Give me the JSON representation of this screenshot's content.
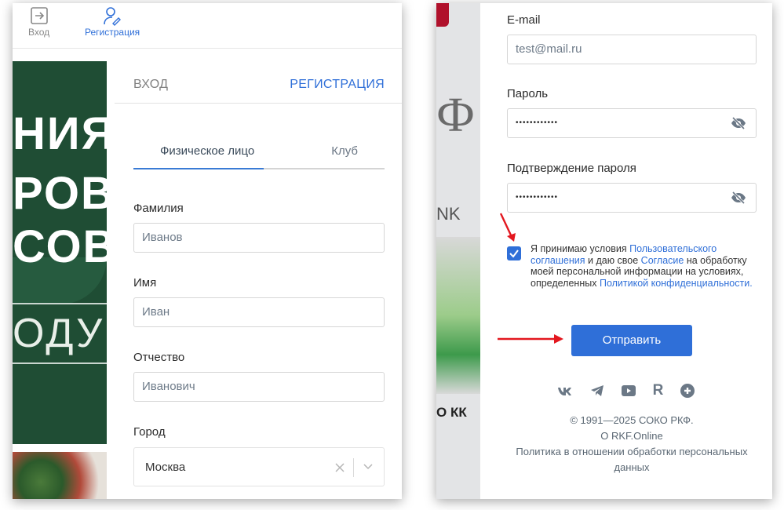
{
  "left": {
    "nav": {
      "login_label": "Вход",
      "register_label": "Регистрация"
    },
    "background": {
      "line1": "НИЯ",
      "line2": "РОВ",
      "line3": "СОВ",
      "line4": "ОДУ"
    },
    "auth_tabs": {
      "login": "ВХОД",
      "register": "РЕГИСТРАЦИЯ"
    },
    "sub_tabs": {
      "physical": "Физическое лицо",
      "club": "Клуб"
    },
    "fields": {
      "surname_label": "Фамилия",
      "surname_placeholder": "Иванов",
      "name_label": "Имя",
      "name_placeholder": "Иван",
      "patronymic_label": "Отчество",
      "patronymic_placeholder": "Иванович",
      "city_label": "Город",
      "city_value": "Москва"
    }
  },
  "right": {
    "background": {
      "letter": "Ф",
      "nk": "NK",
      "kk": "О КК"
    },
    "email_label": "E-mail",
    "email_value": "test@mail.ru",
    "password_label": "Пароль",
    "password_value": "••••••••••••",
    "confirm_label": "Подтверждение пароля",
    "confirm_value": "••••••••••••",
    "consent": {
      "text1": "Я принимаю условия ",
      "link1": "Пользовательского соглашения",
      "text2": " и даю свое ",
      "link2": "Согласие",
      "text3": " на обработку моей персональной информации на условиях, определенных ",
      "link3": "Политикой конфиденциальности."
    },
    "submit_label": "Отправить",
    "social_icons": [
      "vk-icon",
      "telegram-icon",
      "youtube-icon",
      "rutube-icon",
      "ok-icon"
    ],
    "social": {
      "rutube_letter": "R"
    },
    "footer": {
      "copyright": "© 1991—2025 СОКО РКФ.",
      "about": "О RKF.Online",
      "policy": "Политика в отношении обработки персональных данных"
    }
  },
  "colors": {
    "accent": "#2f6fd8",
    "arrow": "#e3171f",
    "bg_green": "#1f4d34"
  }
}
